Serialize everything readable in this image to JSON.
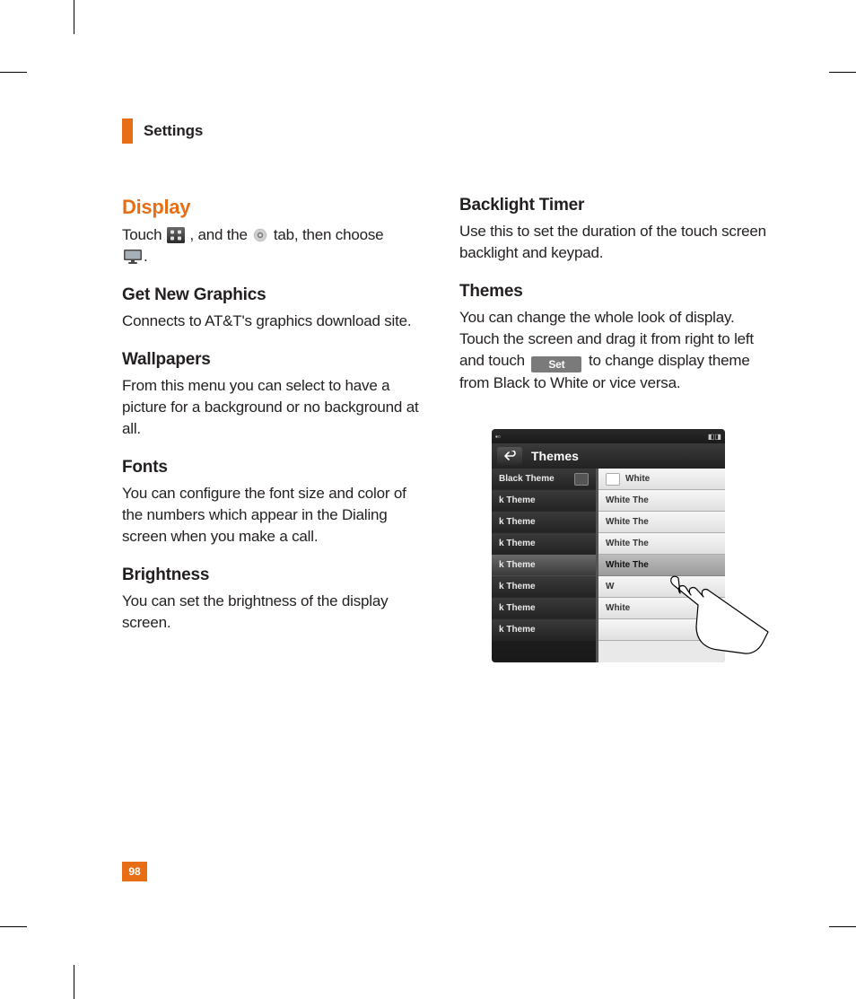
{
  "header": {
    "title": "Settings"
  },
  "left": {
    "display_heading": "Display",
    "display_intro_1": "Touch",
    "display_intro_2": ", and the",
    "display_intro_3": "tab, then choose",
    "display_intro_4": ".",
    "getnew_h": "Get New Graphics",
    "getnew_p": "Connects to AT&T's graphics download site.",
    "wallpapers_h": "Wallpapers",
    "wallpapers_p": "From this menu you can select to have a picture for a background or no background at all.",
    "fonts_h": "Fonts",
    "fonts_p": "You can configure the font size and color of the numbers which appear in the Dialing screen when you make a call.",
    "brightness_h": "Brightness",
    "brightness_p": "You can set the brightness of the display screen."
  },
  "right": {
    "backlight_h": "Backlight Timer",
    "backlight_p": "Use this to set the duration of the touch screen backlight and keypad.",
    "themes_h": "Themes",
    "themes_p1": "You can change the whole look of display. Touch the screen and drag it from right to left and touch",
    "themes_set": "Set",
    "themes_p2": "to change display theme from Black to White or vice versa."
  },
  "figure": {
    "status_left": "▪▫",
    "status_right": "◧◨",
    "title": "Themes",
    "black_rows": [
      {
        "label": "Black Theme",
        "chip": true
      },
      {
        "label": "k Theme"
      },
      {
        "label": "k Theme"
      },
      {
        "label": "k Theme"
      },
      {
        "label": "k Theme",
        "sel": true
      },
      {
        "label": "k Theme"
      },
      {
        "label": "k Theme"
      },
      {
        "label": "k Theme"
      }
    ],
    "white_rows": [
      {
        "label": "White",
        "chip": true
      },
      {
        "label": "White The"
      },
      {
        "label": "White The"
      },
      {
        "label": "White The"
      },
      {
        "label": "White The",
        "sel": true
      },
      {
        "label": "W"
      },
      {
        "label": "White"
      },
      {
        "label": ""
      }
    ]
  },
  "page_number": "98"
}
